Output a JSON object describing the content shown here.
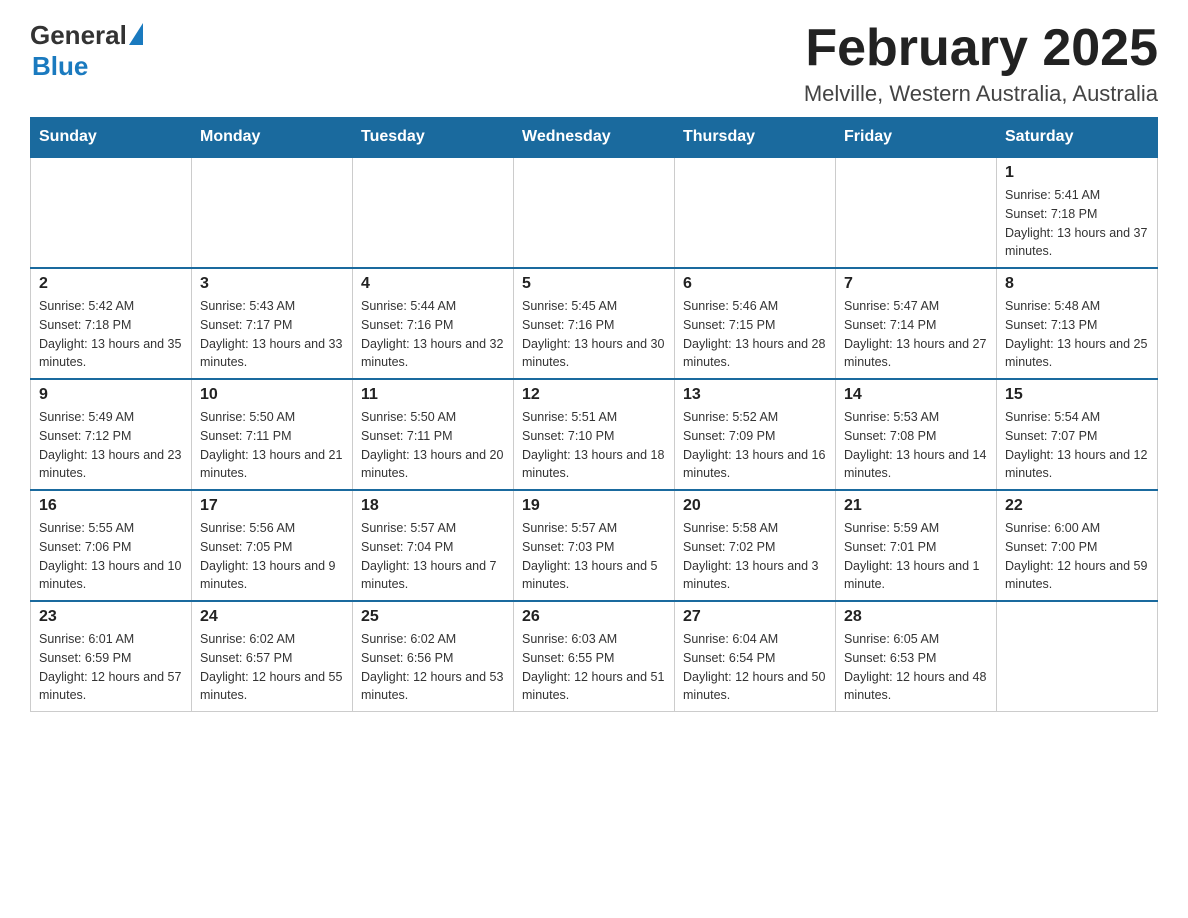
{
  "header": {
    "logo": {
      "general": "General",
      "blue": "Blue",
      "triangle": "▶"
    },
    "month_title": "February 2025",
    "location": "Melville, Western Australia, Australia"
  },
  "calendar": {
    "days_of_week": [
      "Sunday",
      "Monday",
      "Tuesday",
      "Wednesday",
      "Thursday",
      "Friday",
      "Saturday"
    ],
    "weeks": [
      [
        null,
        null,
        null,
        null,
        null,
        null,
        {
          "day": "1",
          "sunrise": "Sunrise: 5:41 AM",
          "sunset": "Sunset: 7:18 PM",
          "daylight": "Daylight: 13 hours and 37 minutes."
        }
      ],
      [
        {
          "day": "2",
          "sunrise": "Sunrise: 5:42 AM",
          "sunset": "Sunset: 7:18 PM",
          "daylight": "Daylight: 13 hours and 35 minutes."
        },
        {
          "day": "3",
          "sunrise": "Sunrise: 5:43 AM",
          "sunset": "Sunset: 7:17 PM",
          "daylight": "Daylight: 13 hours and 33 minutes."
        },
        {
          "day": "4",
          "sunrise": "Sunrise: 5:44 AM",
          "sunset": "Sunset: 7:16 PM",
          "daylight": "Daylight: 13 hours and 32 minutes."
        },
        {
          "day": "5",
          "sunrise": "Sunrise: 5:45 AM",
          "sunset": "Sunset: 7:16 PM",
          "daylight": "Daylight: 13 hours and 30 minutes."
        },
        {
          "day": "6",
          "sunrise": "Sunrise: 5:46 AM",
          "sunset": "Sunset: 7:15 PM",
          "daylight": "Daylight: 13 hours and 28 minutes."
        },
        {
          "day": "7",
          "sunrise": "Sunrise: 5:47 AM",
          "sunset": "Sunset: 7:14 PM",
          "daylight": "Daylight: 13 hours and 27 minutes."
        },
        {
          "day": "8",
          "sunrise": "Sunrise: 5:48 AM",
          "sunset": "Sunset: 7:13 PM",
          "daylight": "Daylight: 13 hours and 25 minutes."
        }
      ],
      [
        {
          "day": "9",
          "sunrise": "Sunrise: 5:49 AM",
          "sunset": "Sunset: 7:12 PM",
          "daylight": "Daylight: 13 hours and 23 minutes."
        },
        {
          "day": "10",
          "sunrise": "Sunrise: 5:50 AM",
          "sunset": "Sunset: 7:11 PM",
          "daylight": "Daylight: 13 hours and 21 minutes."
        },
        {
          "day": "11",
          "sunrise": "Sunrise: 5:50 AM",
          "sunset": "Sunset: 7:11 PM",
          "daylight": "Daylight: 13 hours and 20 minutes."
        },
        {
          "day": "12",
          "sunrise": "Sunrise: 5:51 AM",
          "sunset": "Sunset: 7:10 PM",
          "daylight": "Daylight: 13 hours and 18 minutes."
        },
        {
          "day": "13",
          "sunrise": "Sunrise: 5:52 AM",
          "sunset": "Sunset: 7:09 PM",
          "daylight": "Daylight: 13 hours and 16 minutes."
        },
        {
          "day": "14",
          "sunrise": "Sunrise: 5:53 AM",
          "sunset": "Sunset: 7:08 PM",
          "daylight": "Daylight: 13 hours and 14 minutes."
        },
        {
          "day": "15",
          "sunrise": "Sunrise: 5:54 AM",
          "sunset": "Sunset: 7:07 PM",
          "daylight": "Daylight: 13 hours and 12 minutes."
        }
      ],
      [
        {
          "day": "16",
          "sunrise": "Sunrise: 5:55 AM",
          "sunset": "Sunset: 7:06 PM",
          "daylight": "Daylight: 13 hours and 10 minutes."
        },
        {
          "day": "17",
          "sunrise": "Sunrise: 5:56 AM",
          "sunset": "Sunset: 7:05 PM",
          "daylight": "Daylight: 13 hours and 9 minutes."
        },
        {
          "day": "18",
          "sunrise": "Sunrise: 5:57 AM",
          "sunset": "Sunset: 7:04 PM",
          "daylight": "Daylight: 13 hours and 7 minutes."
        },
        {
          "day": "19",
          "sunrise": "Sunrise: 5:57 AM",
          "sunset": "Sunset: 7:03 PM",
          "daylight": "Daylight: 13 hours and 5 minutes."
        },
        {
          "day": "20",
          "sunrise": "Sunrise: 5:58 AM",
          "sunset": "Sunset: 7:02 PM",
          "daylight": "Daylight: 13 hours and 3 minutes."
        },
        {
          "day": "21",
          "sunrise": "Sunrise: 5:59 AM",
          "sunset": "Sunset: 7:01 PM",
          "daylight": "Daylight: 13 hours and 1 minute."
        },
        {
          "day": "22",
          "sunrise": "Sunrise: 6:00 AM",
          "sunset": "Sunset: 7:00 PM",
          "daylight": "Daylight: 12 hours and 59 minutes."
        }
      ],
      [
        {
          "day": "23",
          "sunrise": "Sunrise: 6:01 AM",
          "sunset": "Sunset: 6:59 PM",
          "daylight": "Daylight: 12 hours and 57 minutes."
        },
        {
          "day": "24",
          "sunrise": "Sunrise: 6:02 AM",
          "sunset": "Sunset: 6:57 PM",
          "daylight": "Daylight: 12 hours and 55 minutes."
        },
        {
          "day": "25",
          "sunrise": "Sunrise: 6:02 AM",
          "sunset": "Sunset: 6:56 PM",
          "daylight": "Daylight: 12 hours and 53 minutes."
        },
        {
          "day": "26",
          "sunrise": "Sunrise: 6:03 AM",
          "sunset": "Sunset: 6:55 PM",
          "daylight": "Daylight: 12 hours and 51 minutes."
        },
        {
          "day": "27",
          "sunrise": "Sunrise: 6:04 AM",
          "sunset": "Sunset: 6:54 PM",
          "daylight": "Daylight: 12 hours and 50 minutes."
        },
        {
          "day": "28",
          "sunrise": "Sunrise: 6:05 AM",
          "sunset": "Sunset: 6:53 PM",
          "daylight": "Daylight: 12 hours and 48 minutes."
        },
        null
      ]
    ]
  }
}
